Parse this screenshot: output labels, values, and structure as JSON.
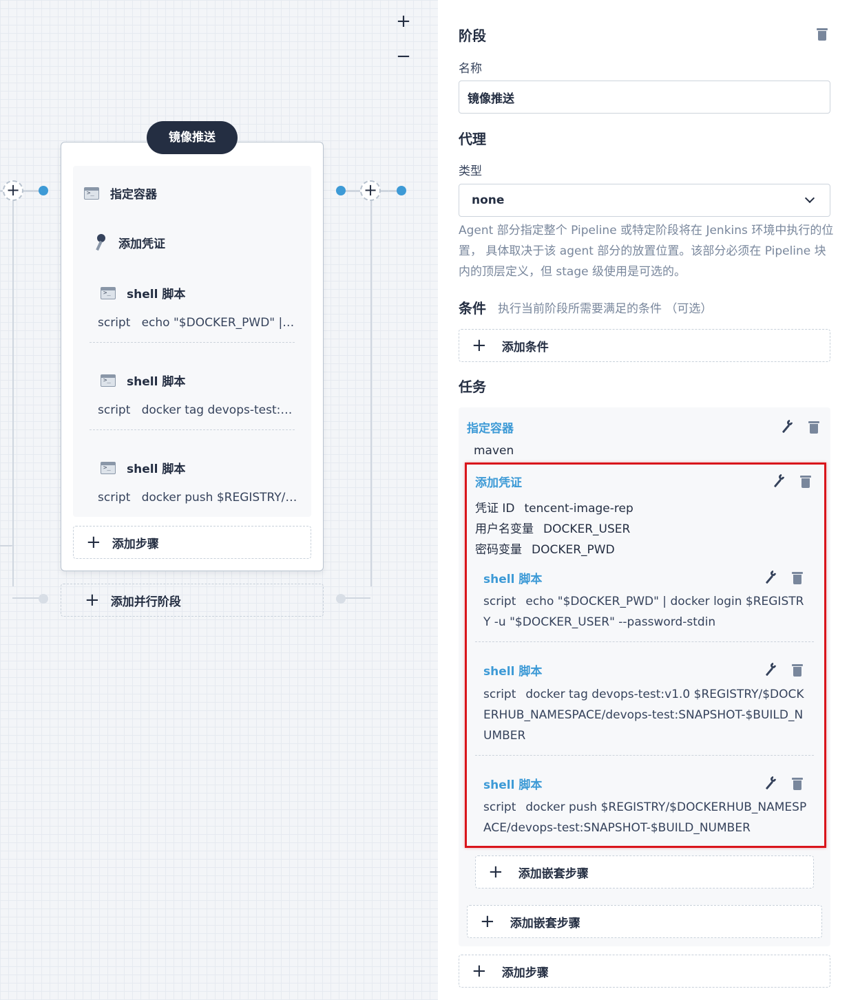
{
  "canvas": {
    "zoom_in": "+",
    "zoom_out": "−",
    "stage_title": "镜像推送",
    "steps": [
      {
        "label": "指定容器"
      },
      {
        "label": "添加凭证"
      },
      {
        "label": "shell 脚本",
        "script_key": "script",
        "script_value": "echo \"$DOCKER_PWD\" | docker login $REGISTRY -u \"$DOCKER_USER\" --password-stdin"
      },
      {
        "label": "shell 脚本",
        "script_key": "script",
        "script_value": "docker tag devops-test:v1.0 $REGISTRY/$DOCKERHUB_NAMESPACE/devops-test:SNAPSHOT-$BUILD_NUMBER"
      },
      {
        "label": "shell 脚本",
        "script_key": "script",
        "script_value": "docker push $REGISTRY/$DOCKERHUB_NAMESPACE/devops-test:SNAPSHOT-$BUILD_NUMBER"
      }
    ],
    "add_step": "添加步骤",
    "add_parallel_stage": "添加并行阶段"
  },
  "panel": {
    "stage_heading": "阶段",
    "name_label": "名称",
    "name_value": "镜像推送",
    "agent_heading": "代理",
    "type_label": "类型",
    "type_value": "none",
    "agent_desc": "Agent 部分指定整个 Pipeline 或特定阶段将在 Jenkins 环境中执行的位置， 具体取决于该 agent 部分的放置位置。该部分必须在 Pipeline 块内的顶层定义，但 stage 级使用是可选的。",
    "condition_heading": "条件",
    "condition_hint": "执行当前阶段所需要满足的条件 （可选）",
    "add_condition": "添加条件",
    "tasks_heading": "任务",
    "container": {
      "title": "指定容器",
      "value": "maven"
    },
    "credential": {
      "title": "添加凭证",
      "id_key": "凭证 ID",
      "id_value": "tencent-image-rep",
      "user_key": "用户名变量",
      "user_value": "DOCKER_USER",
      "pwd_key": "密码变量",
      "pwd_value": "DOCKER_PWD"
    },
    "shells": [
      {
        "title": "shell 脚本",
        "key": "script",
        "value": "echo \"$DOCKER_PWD\" | docker login $REGISTRY -u \"$DOCKER_USER\" --password-stdin"
      },
      {
        "title": "shell 脚本",
        "key": "script",
        "value": "docker tag devops-test:v1.0 $REGISTRY/$DOCKERHUB_NAMESPACE/devops-test:SNAPSHOT-$BUILD_NUMBER"
      },
      {
        "title": "shell 脚本",
        "key": "script",
        "value": "docker push $REGISTRY/$DOCKERHUB_NAMESPACE/devops-test:SNAPSHOT-$BUILD_NUMBER"
      }
    ],
    "add_nested_inner": "添加嵌套步骤",
    "add_nested_outer": "添加嵌套步骤",
    "add_step": "添加步骤"
  },
  "colors": {
    "accent": "#3d9ad6",
    "dark": "#242e42",
    "highlight": "#d9141b"
  }
}
